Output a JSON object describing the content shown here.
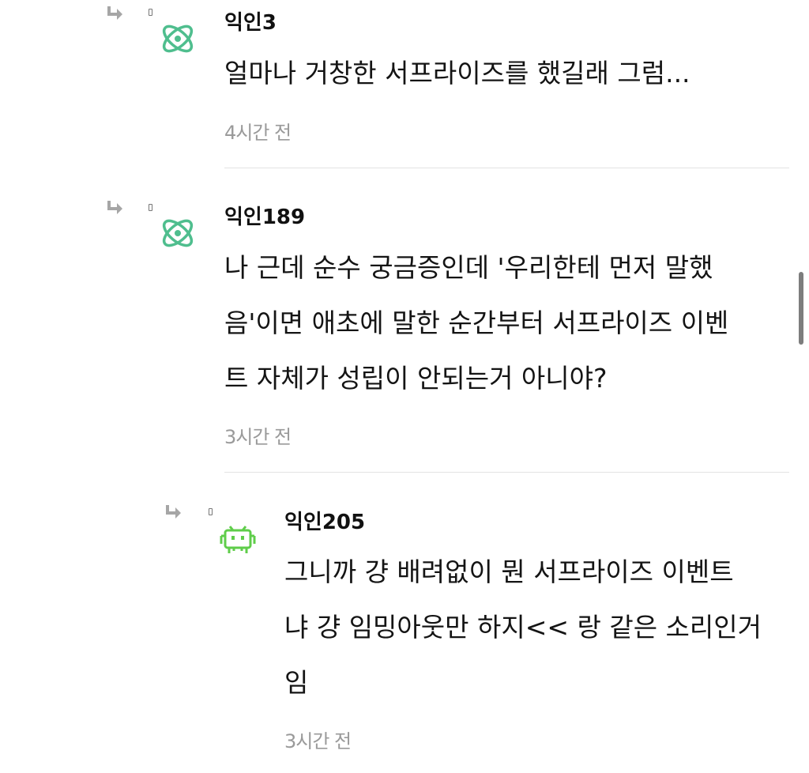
{
  "comments": [
    {
      "author": "익인3",
      "lines": [
        "얼마나 거창한 서프라이즈를 했길래 그럼..."
      ],
      "time": "4시간 전",
      "avatar": "atom-icon"
    },
    {
      "author": "익인189",
      "lines": [
        "나 근데 순수 궁금증인데 '우리한테 먼저 말했",
        "음'이면 애초에 말한 순간부터 서프라이즈 이벤",
        "트 자체가 성립이 안되는거 아니야?"
      ],
      "time": "3시간 전",
      "avatar": "atom-icon"
    },
    {
      "author": "익인205",
      "lines": [
        "그니까 걍 배려없이 뭔 서프라이즈 이벤트",
        "냐 걍 임밍아웃만 하지<< 랑 같은 소리인거",
        "임"
      ],
      "time": "3시간 전",
      "avatar": "space-invader-icon"
    }
  ],
  "colors": {
    "atom": "#4fbe8e",
    "invader": "#5fcd4a",
    "time": "#9a9a9a",
    "divider": "#e3e3e3",
    "reply_arrow": "#a6a6a6"
  }
}
